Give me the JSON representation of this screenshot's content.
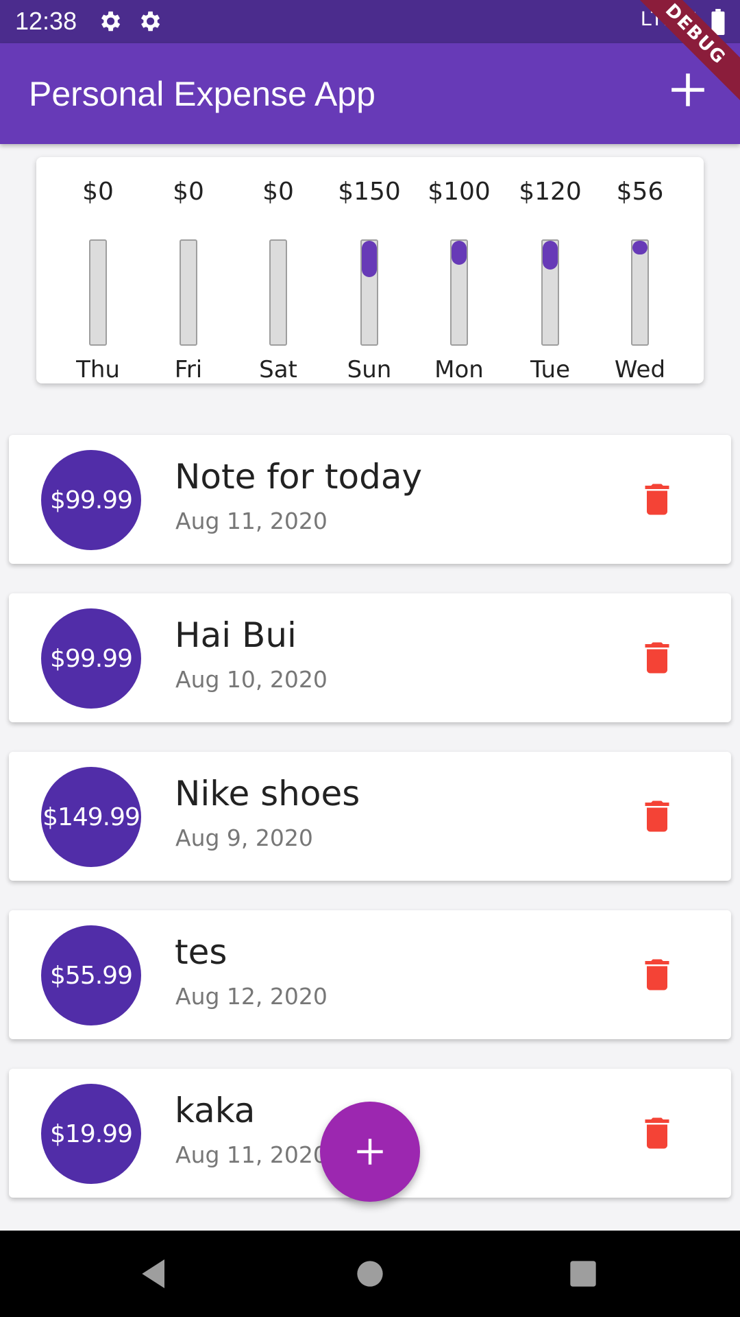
{
  "status_bar": {
    "time": "12:38",
    "network": "LTE"
  },
  "app_bar": {
    "title": "Personal Expense App",
    "debug_label": "DEBUG"
  },
  "chart": {
    "days": [
      {
        "amount": "$0",
        "day": "Thu",
        "fill_fraction": 0.0
      },
      {
        "amount": "$0",
        "day": "Fri",
        "fill_fraction": 0.0
      },
      {
        "amount": "$0",
        "day": "Sat",
        "fill_fraction": 0.0
      },
      {
        "amount": "$150",
        "day": "Sun",
        "fill_fraction": 0.35
      },
      {
        "amount": "$100",
        "day": "Mon",
        "fill_fraction": 0.23
      },
      {
        "amount": "$120",
        "day": "Tue",
        "fill_fraction": 0.28
      },
      {
        "amount": "$56",
        "day": "Wed",
        "fill_fraction": 0.13
      }
    ]
  },
  "transactions": [
    {
      "amount": "$99.99",
      "title": "Note for today",
      "date": "Aug 11, 2020"
    },
    {
      "amount": "$99.99",
      "title": "Hai Bui",
      "date": "Aug 10, 2020"
    },
    {
      "amount": "$149.99",
      "title": "Nike shoes",
      "date": "Aug 9, 2020"
    },
    {
      "amount": "$55.99",
      "title": "tes",
      "date": "Aug 12, 2020"
    },
    {
      "amount": "$19.99",
      "title": "kaka",
      "date": "Aug 11, 2020"
    }
  ],
  "icons": {
    "settings": "gear-icon",
    "add": "plus-icon",
    "delete": "trash-icon",
    "nav_back": "back-triangle-icon",
    "nav_home": "home-circle-icon",
    "nav_recents": "recents-square-icon"
  },
  "colors": {
    "primary": "#673ab7",
    "primary_dark": "#4b2c8d",
    "avatar": "#512da8",
    "fab": "#9c27b0",
    "delete": "#f44336"
  }
}
